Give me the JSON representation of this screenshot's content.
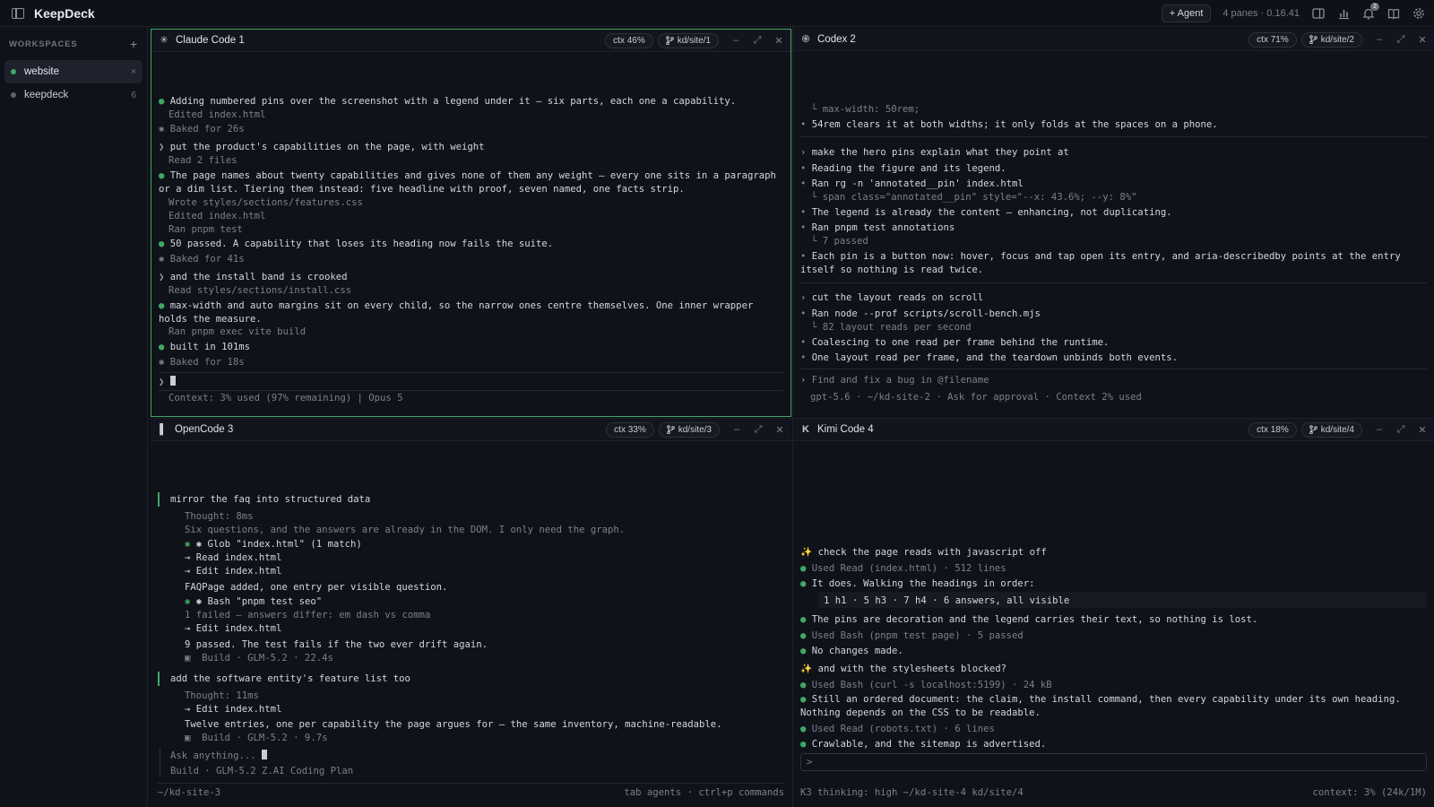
{
  "app": {
    "title": "KeepDeck"
  },
  "titlebar": {
    "agent_button": "+ Agent",
    "pane_info": "4 panes · 0.16.41",
    "notifications_count": "2"
  },
  "sidebar": {
    "header": "WORKSPACES",
    "items": [
      {
        "label": "website",
        "meta": "×",
        "status_color": "#3fa866"
      },
      {
        "label": "keepdeck",
        "meta": "6",
        "status_color": "#5b606a"
      }
    ]
  },
  "panes": {
    "p1": {
      "title": "Claude Code 1",
      "ctx": "ctx 46%",
      "branch": "kd/site/1",
      "lines": [
        "Adding numbered pins over the screenshot with a legend under it — six parts, each one a capability.",
        "Edited index.html",
        "✱ Baked for 26s",
        "put the product's capabilities on the page, with weight",
        "Read 2 files",
        "The page names about twenty capabilities and gives none of them any weight — every one sits in a paragraph or a dim list. Tiering them instead: five headline with proof, seven named, one facts strip.",
        "Wrote styles/sections/features.css",
        "Edited index.html",
        "Ran pnpm test",
        "50 passed. A capability that loses its heading now fails the suite.",
        "✱ Baked for 41s",
        "and the install band is crooked",
        "Read styles/sections/install.css",
        "max-width and auto margins sit on every child, so the narrow ones centre themselves. One inner wrapper holds the measure.",
        "Ran pnpm exec vite build",
        "built in 101ms",
        "✱ Baked for 18s"
      ],
      "status": "Context: 3% used (97% remaining) | Opus 5"
    },
    "p2": {
      "title": "Codex 2",
      "ctx": "ctx 71%",
      "branch": "kd/site/2",
      "lines": [
        "└ max-width: 50rem;",
        "54rem clears it at both widths; it only folds at the spaces on a phone.",
        "make the hero pins explain what they point at",
        "Reading the figure and its legend.",
        "Ran rg -n 'annotated__pin' index.html",
        "└ span class=\"annotated__pin\" style=\"--x: 43.6%; --y: 8%\"",
        "The legend is already the content — enhancing, not duplicating.",
        "Ran pnpm test annotations",
        "└ 7 passed",
        "Each pin is a button now: hover, focus and tap open its entry, and aria-describedby points at the entry itself so nothing is read twice.",
        "cut the layout reads on scroll",
        "Ran node --prof scripts/scroll-bench.mjs",
        "└ 82 layout reads per second",
        "Coalescing to one read per frame behind the runtime.",
        "One layout read per frame, and the teardown unbinds both events."
      ],
      "input_placeholder": "Find and fix a bug in @filename",
      "status": "gpt-5.6 · ~/kd-site-2 · Ask for approval · Context 2% used"
    },
    "p3": {
      "title": "OpenCode 3",
      "ctx": "ctx 33%",
      "branch": "kd/site/3",
      "lines": [
        "mirror the faq into structured data",
        "Thought: 8ms",
        "Six questions, and the answers are already in the DOM. I only need the graph.",
        "✱ Glob \"index.html\" (1 match)",
        "→ Read index.html",
        "→ Edit index.html",
        "FAQPage added, one entry per visible question.",
        "✱ Bash \"pnpm test seo\"",
        "1 failed — answers differ: em dash vs comma",
        "→ Edit index.html",
        "9 passed. The test fails if the two ever drift again.",
        "▣  Build · GLM-5.2 · 22.4s",
        "add the software entity's feature list too",
        "Thought: 11ms",
        "→ Edit index.html",
        "Twelve entries, one per capability the page argues for — the same inventory, machine-readable.",
        "▣  Build · GLM-5.2 · 9.7s"
      ],
      "input_placeholder": "Ask anything...",
      "input_sub": "Build · GLM-5.2 Z.AI Coding Plan",
      "footer_left": "~/kd-site-3",
      "footer_right": "tab agents · ctrl+p commands"
    },
    "p4": {
      "title": "Kimi Code 4",
      "ctx": "ctx 18%",
      "branch": "kd/site/4",
      "lines": [
        "check the page reads with javascript off",
        "Used Read (index.html) · 512 lines",
        "It does. Walking the headings in order:",
        "1 h1 · 5 h3 · 7 h4 · 6 answers, all visible",
        "The pins are decoration and the legend carries their text, so nothing is lost.",
        "Used Bash (pnpm test page) · 5 passed",
        "No changes made.",
        "and with the stylesheets blocked?",
        "Used Bash (curl -s localhost:5199) · 24 kB",
        "Still an ordered document: the claim, the install command, then every capability under its own heading. Nothing depends on the CSS to be readable.",
        "Used Read (robots.txt) · 6 lines",
        "Crawlable, and the sitemap is advertised."
      ],
      "input_prompt": ">",
      "footer_left": "K3 thinking: high ~/kd-site-4 kd/site/4",
      "footer_right": "context: 3% (24k/1M)"
    }
  }
}
